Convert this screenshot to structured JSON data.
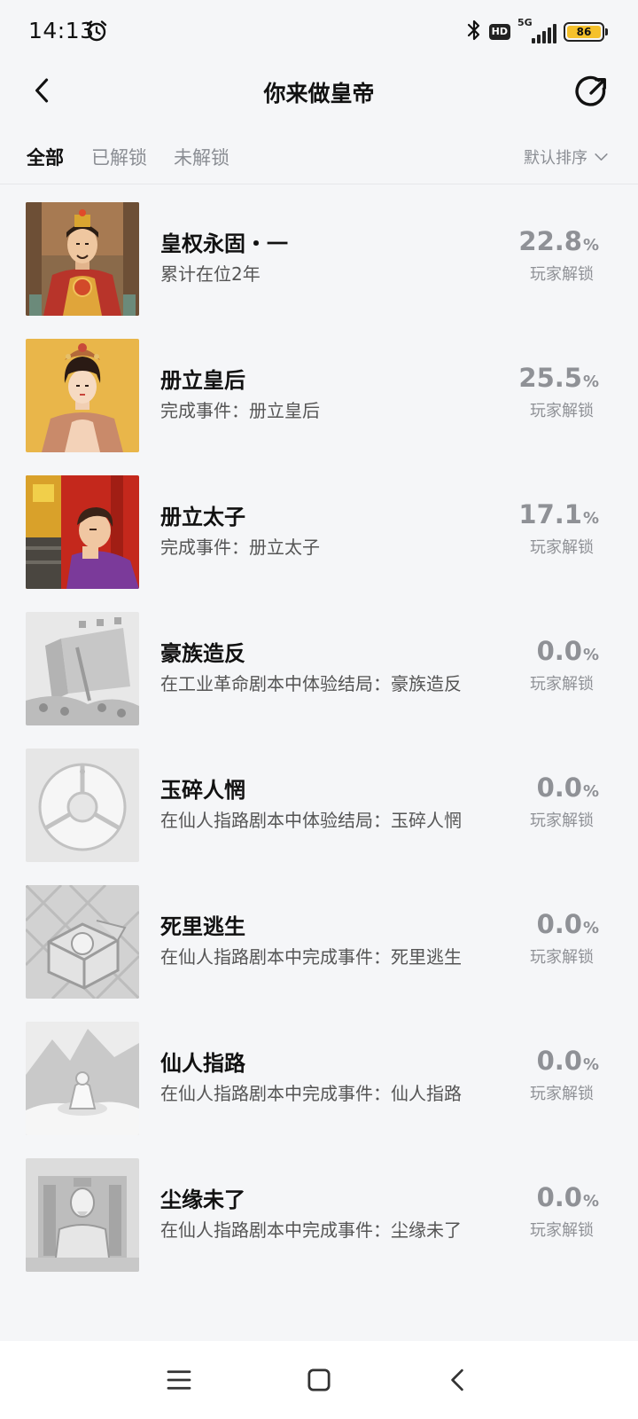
{
  "status_bar": {
    "time": "14:13",
    "network": "5G",
    "hd_badge": "HD",
    "battery": "86"
  },
  "nav": {
    "title": "你来做皇帝"
  },
  "tabs": [
    {
      "label": "全部",
      "active": true
    },
    {
      "label": "已解锁",
      "active": false
    },
    {
      "label": "未解锁",
      "active": false
    }
  ],
  "sort": {
    "label": "默认排序"
  },
  "achievements": [
    {
      "title": "皇权永固・一",
      "desc": "累计在位2年",
      "percent": "22.8",
      "unit": "%",
      "percent_label": "玩家解锁",
      "unlocked": true
    },
    {
      "title": "册立皇后",
      "desc": "完成事件：册立皇后",
      "percent": "25.5",
      "unit": "%",
      "percent_label": "玩家解锁",
      "unlocked": true
    },
    {
      "title": "册立太子",
      "desc": "完成事件：册立太子",
      "percent": "17.1",
      "unit": "%",
      "percent_label": "玩家解锁",
      "unlocked": true
    },
    {
      "title": "豪族造反",
      "desc": "在工业革命剧本中体验结局：豪族造反",
      "percent": "0.0",
      "unit": "%",
      "percent_label": "玩家解锁",
      "unlocked": false
    },
    {
      "title": "玉碎人惘",
      "desc": "在仙人指路剧本中体验结局：玉碎人惘",
      "percent": "0.0",
      "unit": "%",
      "percent_label": "玩家解锁",
      "unlocked": false
    },
    {
      "title": "死里逃生",
      "desc": "在仙人指路剧本中完成事件：死里逃生",
      "percent": "0.0",
      "unit": "%",
      "percent_label": "玩家解锁",
      "unlocked": false
    },
    {
      "title": "仙人指路",
      "desc": "在仙人指路剧本中完成事件：仙人指路",
      "percent": "0.0",
      "unit": "%",
      "percent_label": "玩家解锁",
      "unlocked": false
    },
    {
      "title": "尘缘未了",
      "desc": "在仙人指路剧本中完成事件：尘缘未了",
      "percent": "0.0",
      "unit": "%",
      "percent_label": "玩家解锁",
      "unlocked": false
    }
  ],
  "colors": {
    "background": "#f5f6f8",
    "text_primary": "#111111",
    "text_secondary": "#555555",
    "text_muted": "#8f9196",
    "battery": "#f5c12b"
  },
  "icons": {
    "back": "chevron-left-icon",
    "share": "share-arrow-icon",
    "sort": "chevron-down-icon",
    "sys_menu": "menu-icon",
    "sys_home": "home-icon",
    "sys_back": "back-icon"
  }
}
